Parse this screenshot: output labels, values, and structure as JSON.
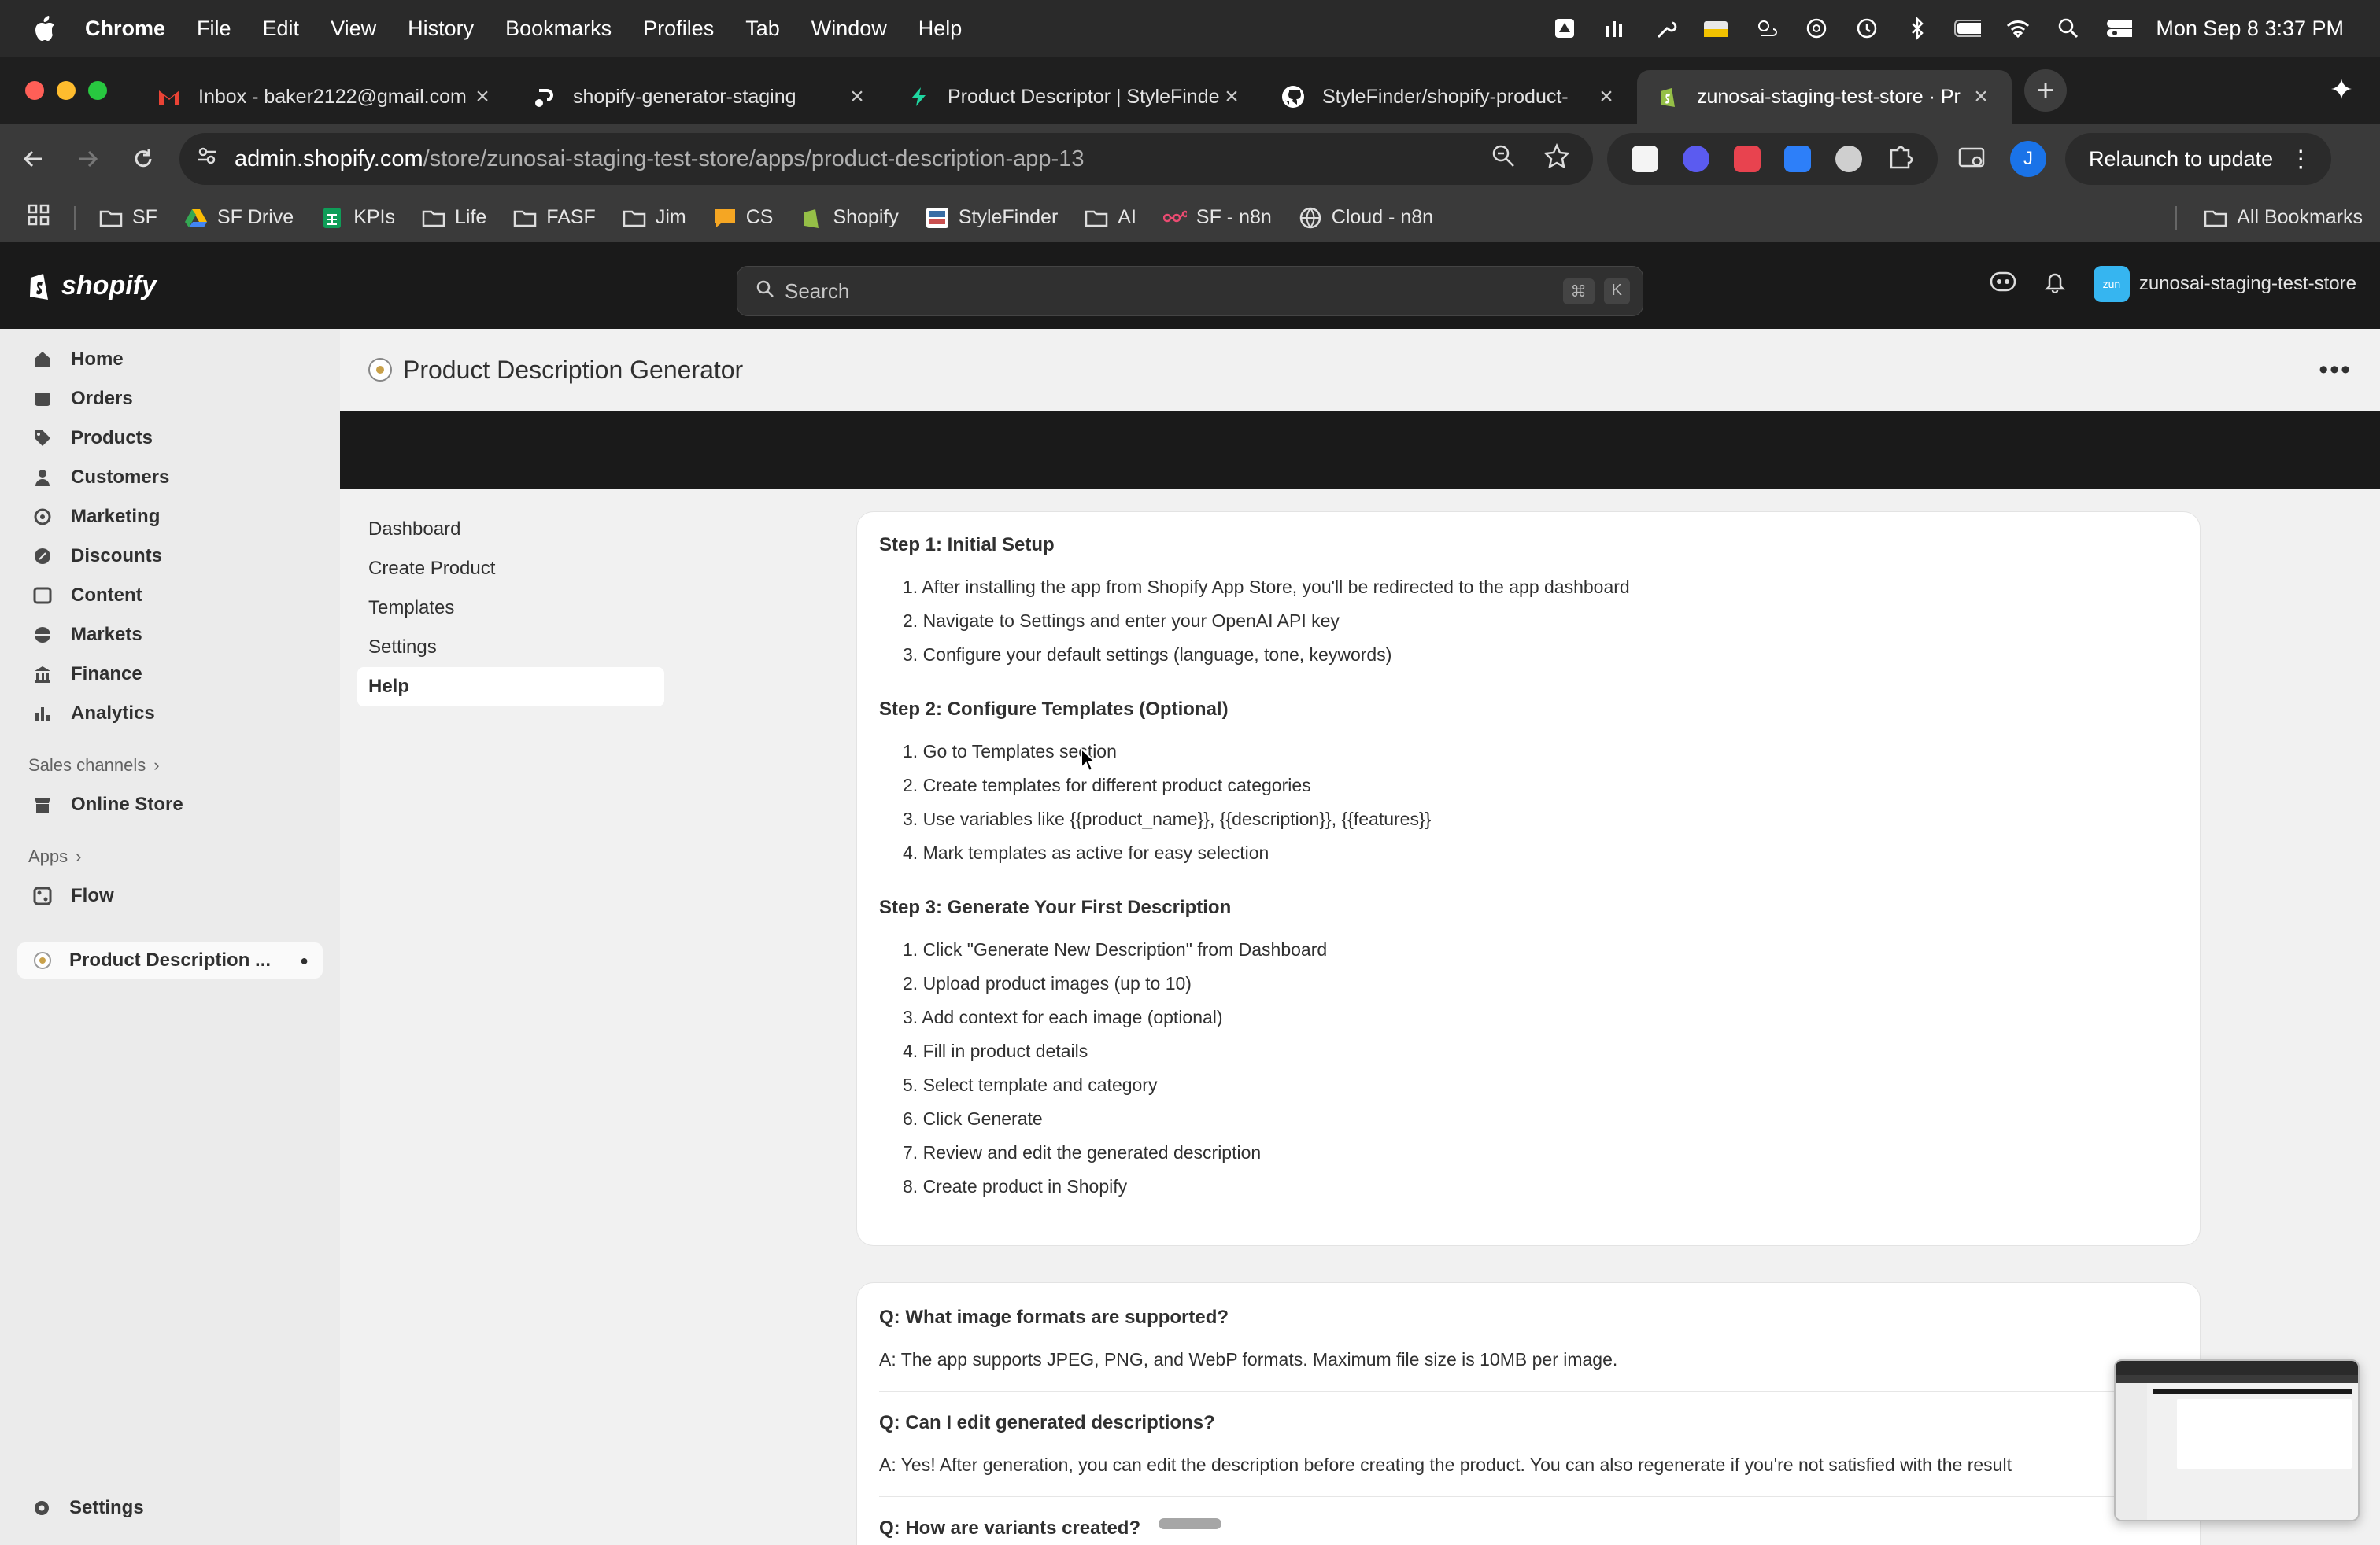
{
  "menubar": {
    "app": "Chrome",
    "items": [
      "File",
      "Edit",
      "View",
      "History",
      "Bookmarks",
      "Profiles",
      "Tab",
      "Window",
      "Help"
    ],
    "datetime": "Mon Sep 8  3:37 PM"
  },
  "tabs": [
    {
      "title": "Inbox - baker2122@gmail.com",
      "icon": "gmail-icon"
    },
    {
      "title": "shopify-generator-staging",
      "icon": "render-icon"
    },
    {
      "title": "Product Descriptor | StyleFinder",
      "icon": "bolt-icon"
    },
    {
      "title": "StyleFinder/shopify-product-",
      "icon": "github-icon"
    },
    {
      "title": "zunosai-staging-test-store · Pr",
      "icon": "shopify-icon"
    }
  ],
  "address": {
    "domain": "admin.shopify.com",
    "path": "/store/zunosai-staging-test-store/apps/product-description-app-13"
  },
  "profile_initial": "J",
  "relaunch_label": "Relaunch to update",
  "bookmarks": [
    {
      "label": "SF",
      "icon": "folder-icon"
    },
    {
      "label": "SF Drive",
      "icon": "drive-icon"
    },
    {
      "label": "KPIs",
      "icon": "sheets-icon"
    },
    {
      "label": "Life",
      "icon": "folder-icon"
    },
    {
      "label": "FASF",
      "icon": "folder-icon"
    },
    {
      "label": "Jim",
      "icon": "folder-icon"
    },
    {
      "label": "CS",
      "icon": "chat-icon"
    },
    {
      "label": "Shopify",
      "icon": "shopify-icon"
    },
    {
      "label": "StyleFinder",
      "icon": "stylefinder-icon"
    },
    {
      "label": "AI",
      "icon": "folder-icon"
    },
    {
      "label": "SF - n8n",
      "icon": "n8n-icon"
    },
    {
      "label": "Cloud - n8n",
      "icon": "globe-icon"
    }
  ],
  "all_bookmarks": "All Bookmarks",
  "shopify": {
    "logo_text": "shopify",
    "search_placeholder": "Search",
    "kbd1": "⌘",
    "kbd2": "K",
    "store_badge": "zun",
    "store_name": "zunosai-staging-test-store"
  },
  "sidebar": {
    "items": [
      "Home",
      "Orders",
      "Products",
      "Customers",
      "Marketing",
      "Discounts",
      "Content",
      "Markets",
      "Finance",
      "Analytics"
    ],
    "sales_channels": "Sales channels",
    "online_store": "Online Store",
    "apps": "Apps",
    "flow": "Flow",
    "active_app": "Product Description ...",
    "settings": "Settings"
  },
  "page": {
    "title": "Product Description Generator",
    "nav": [
      "Dashboard",
      "Create Product",
      "Templates",
      "Settings",
      "Help"
    ]
  },
  "steps": [
    {
      "title": "Step 1: Initial Setup",
      "items": [
        "1. After installing the app from Shopify App Store, you'll be redirected to the app dashboard",
        "2. Navigate to Settings and enter your OpenAI API key",
        "3. Configure your default settings (language, tone, keywords)"
      ]
    },
    {
      "title": "Step 2: Configure Templates (Optional)",
      "items": [
        "1. Go to Templates section",
        "2. Create templates for different product categories",
        "3. Use variables like {{product_name}}, {{description}}, {{features}}",
        "4. Mark templates as active for easy selection"
      ]
    },
    {
      "title": "Step 3: Generate Your First Description",
      "items": [
        "1. Click \"Generate New Description\" from Dashboard",
        "2. Upload product images (up to 10)",
        "3. Add context for each image (optional)",
        "4. Fill in product details",
        "5. Select template and category",
        "6. Click Generate",
        "7. Review and edit the generated description",
        "8. Create product in Shopify"
      ]
    }
  ],
  "faq": [
    {
      "q": "Q: What image formats are supported?",
      "a": "A: The app supports JPEG, PNG, and WebP formats. Maximum file size is 10MB per image."
    },
    {
      "q": "Q: Can I edit generated descriptions?",
      "a": "A: Yes! After generation, you can edit the description before creating the product. You can also regenerate if you're not satisfied with the result"
    },
    {
      "q": "Q: How are variants created?",
      "a": ""
    }
  ],
  "colors": {
    "shopify_green": "#95bf47",
    "profile_blue": "#1a73e8",
    "store_badge": "#36b5f0"
  }
}
